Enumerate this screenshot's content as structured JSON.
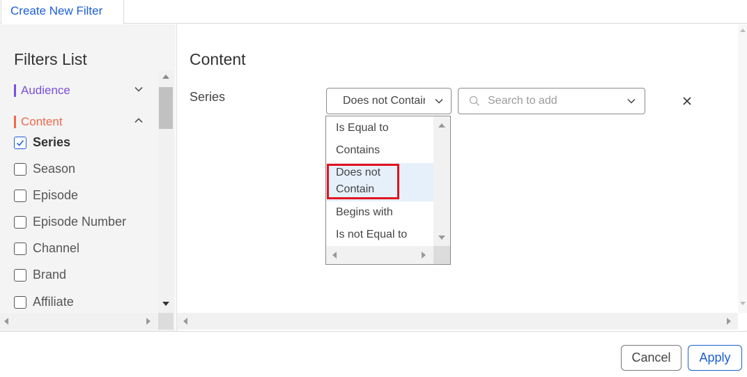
{
  "tab": {
    "label": "Create New Filter"
  },
  "filters_list": {
    "title": "Filters List",
    "categories": [
      {
        "label": "Audience",
        "color": "#7a4fe0",
        "expanded": false
      },
      {
        "label": "Content",
        "color": "#ef6a4a",
        "expanded": true
      }
    ],
    "options": [
      {
        "label": "Series",
        "checked": true
      },
      {
        "label": "Season",
        "checked": false
      },
      {
        "label": "Episode",
        "checked": false
      },
      {
        "label": "Episode Number",
        "checked": false
      },
      {
        "label": "Channel",
        "checked": false
      },
      {
        "label": "Brand",
        "checked": false
      },
      {
        "label": "Affiliate",
        "checked": false
      }
    ]
  },
  "content_panel": {
    "title": "Content",
    "field_label": "Series",
    "condition_value": "Does not Contain",
    "search_placeholder": "Search to add",
    "condition_options": [
      {
        "label": "Is Equal to"
      },
      {
        "label": "Contains"
      },
      {
        "label": "Does not Contain",
        "line1": "Does not",
        "line2": "Contain",
        "highlighted": true
      },
      {
        "label": "Begins with"
      },
      {
        "label": "Is not Equal to"
      }
    ]
  },
  "footer": {
    "cancel_label": "Cancel",
    "apply_label": "Apply"
  },
  "colors": {
    "accent": "#1c5fd6",
    "highlight_border": "#e0131f",
    "hover_row": "#e6f0fb"
  }
}
